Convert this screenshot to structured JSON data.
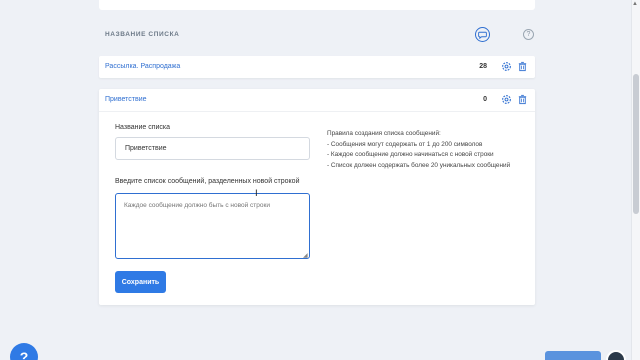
{
  "header": {
    "title": "НАЗВАНИЕ СПИСКА",
    "chat_icon": "chat-bubble-icon",
    "help_icon": "question-icon",
    "help_symbol": "?"
  },
  "lists": [
    {
      "name": "Рассылка. Распродажа",
      "count": "28"
    }
  ],
  "expanded": {
    "name": "Приветствие",
    "count": "0",
    "form": {
      "name_label": "Название списка",
      "name_value": "Приветствие",
      "messages_label": "Введите список сообщений, разделенных новой строкой",
      "messages_placeholder": "Каждое сообщение должно быть с новой строки",
      "save_label": "Сохранить"
    },
    "rules": {
      "title": "Правила создания списка сообщений:",
      "items": [
        "- Сообщения могут содержать от 1 до 200 символов",
        "- Каждое сообщение должно начинаться с новой строки",
        "- Список должен содержать более 20 уникальных сообщений"
      ]
    }
  },
  "support": {
    "icon": "question-icon",
    "symbol": "?"
  },
  "colors": {
    "accent": "#2f7ae5",
    "link": "#2f6fd1",
    "background": "#eef1f6"
  }
}
